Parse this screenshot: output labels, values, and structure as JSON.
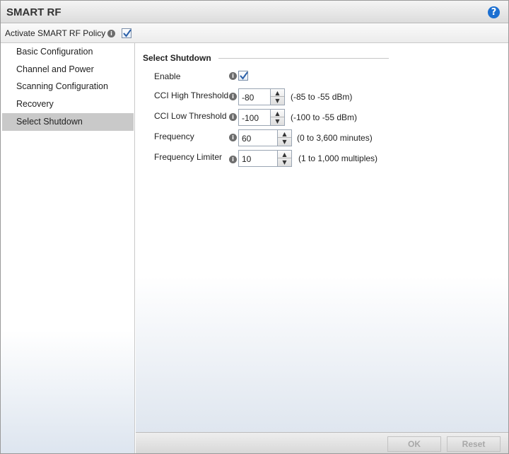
{
  "window": {
    "title": "SMART RF"
  },
  "policy": {
    "label": "Activate SMART RF Policy",
    "checked": true
  },
  "sidebar": {
    "items": [
      {
        "label": "Basic Configuration"
      },
      {
        "label": "Channel and Power"
      },
      {
        "label": "Scanning Configuration"
      },
      {
        "label": "Recovery"
      },
      {
        "label": "Select Shutdown",
        "active": true
      }
    ]
  },
  "section": {
    "title": "Select Shutdown"
  },
  "form": {
    "enable": {
      "label": "Enable",
      "checked": true
    },
    "cci_high": {
      "label": "CCI High Threshold",
      "value": "-80",
      "range": "(-85 to -55 dBm)"
    },
    "cci_low": {
      "label": "CCI Low  Threshold",
      "value": "-100",
      "range": "(-100 to -55 dBm)"
    },
    "frequency": {
      "label": "Frequency",
      "value": "60",
      "range": "(0 to 3,600 minutes)"
    },
    "frequency_limiter": {
      "label": "Frequency Limiter",
      "value": "10",
      "range": "(1 to 1,000 multiples)"
    }
  },
  "footer": {
    "ok_label": "OK",
    "reset_label": "Reset"
  },
  "icons": {
    "help": "help-icon",
    "info": "info-icon",
    "check": "checkmark-icon"
  },
  "colors": {
    "accent": "#1b6fd1",
    "selected_nav": "#c9c9c9",
    "checkmark": "#2a5fa8"
  }
}
